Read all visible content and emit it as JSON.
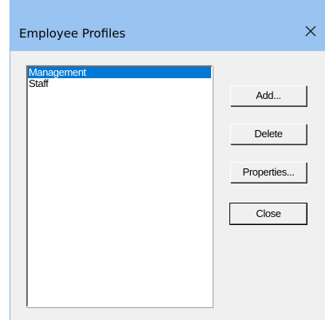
{
  "window": {
    "title": "Employee Profiles"
  },
  "profiles": {
    "items": [
      {
        "label": "Management",
        "selected": true
      },
      {
        "label": "Staff",
        "selected": false
      }
    ]
  },
  "buttons": {
    "add_label": "Add...",
    "delete_label": "Delete",
    "properties_label": "Properties...",
    "close_label": "Close"
  },
  "icons": {
    "close": "close-icon"
  },
  "colors": {
    "titlebar": "#99c3f0",
    "selection": "#0078d7",
    "dialog_bg": "#f0f0f0"
  }
}
